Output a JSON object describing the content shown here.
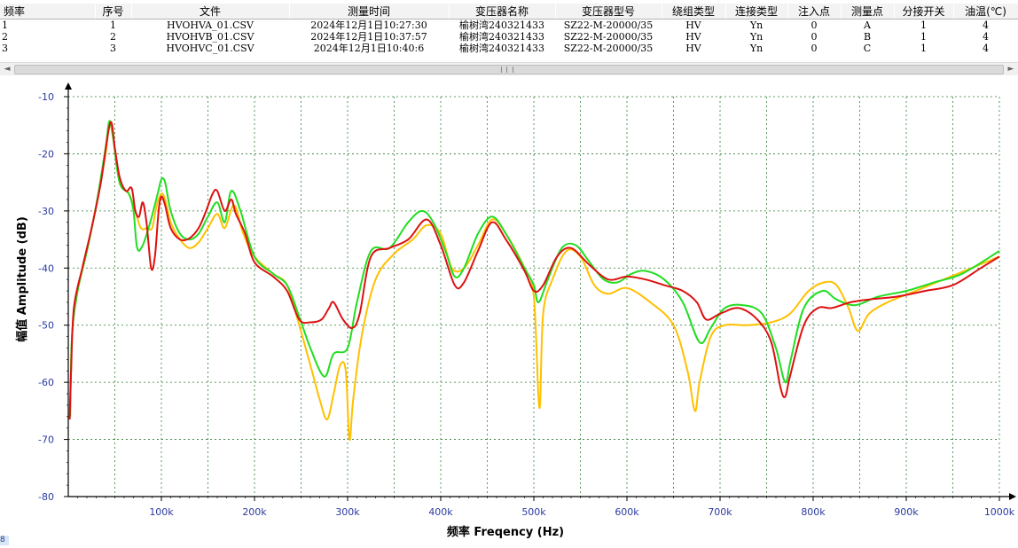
{
  "table": {
    "columns": [
      "频率",
      "序号",
      "文件",
      "测量时间",
      "变压器名称",
      "变压器型号",
      "绕组类型",
      "连接类型",
      "注入点",
      "测量点",
      "分接开关",
      "油温(℃)"
    ],
    "rows": [
      [
        "1",
        "1",
        "HVOHVA_01.CSV",
        "2024年12月1日10:27:30",
        "榆树湾240321433",
        "SZ22-M-20000/35",
        "HV",
        "Yn",
        "0",
        "A",
        "1",
        "4"
      ],
      [
        "2",
        "2",
        "HVOHVB_01.CSV",
        "2024年12月1日10:37:57",
        "榆树湾240321433",
        "SZ22-M-20000/35",
        "HV",
        "Yn",
        "0",
        "B",
        "1",
        "4"
      ],
      [
        "3",
        "3",
        "HVOHVC_01.CSV",
        "2024年12月1日10:40:6",
        "榆树湾240321433",
        "SZ22-M-20000/35",
        "HV",
        "Yn",
        "0",
        "C",
        "1",
        "4"
      ]
    ]
  },
  "scrollbar": {
    "left_arrow": "◄",
    "right_arrow": "►"
  },
  "corner_tag": "8",
  "chart_data": {
    "type": "line",
    "title": "",
    "xlabel": "频率 Freqency (Hz)",
    "ylabel": "幅值 Amplitude (dB)",
    "xlim": [
      0,
      1000000
    ],
    "ylim": [
      -80,
      -10
    ],
    "x_ticks": [
      100000,
      200000,
      300000,
      400000,
      500000,
      600000,
      700000,
      800000,
      900000,
      1000000
    ],
    "x_tick_labels": [
      "100k",
      "200k",
      "300k",
      "400k",
      "500k",
      "600k",
      "700k",
      "800k",
      "900k",
      "1000k"
    ],
    "y_ticks": [
      -10,
      -20,
      -30,
      -40,
      -50,
      -60,
      -70,
      -80
    ],
    "y_tick_labels": [
      "-10",
      "-20",
      "-30",
      "-40",
      "-50",
      "-60",
      "-70",
      "-80"
    ],
    "grid": true,
    "series": [
      {
        "color": "#ffc000",
        "points": [
          [
            2000,
            -66
          ],
          [
            4000,
            -52
          ],
          [
            10000,
            -44
          ],
          [
            20000,
            -37
          ],
          [
            30000,
            -29
          ],
          [
            40000,
            -20
          ],
          [
            44000,
            -15
          ],
          [
            48000,
            -17
          ],
          [
            55000,
            -25
          ],
          [
            65000,
            -27
          ],
          [
            72000,
            -30
          ],
          [
            78000,
            -33
          ],
          [
            85000,
            -33
          ],
          [
            90000,
            -33
          ],
          [
            95000,
            -29
          ],
          [
            100000,
            -27
          ],
          [
            104000,
            -28
          ],
          [
            110000,
            -32
          ],
          [
            120000,
            -35
          ],
          [
            130000,
            -36.5
          ],
          [
            140000,
            -35.5
          ],
          [
            150000,
            -33
          ],
          [
            160000,
            -30.5
          ],
          [
            168000,
            -33
          ],
          [
            178000,
            -29
          ],
          [
            188000,
            -34
          ],
          [
            200000,
            -38
          ],
          [
            220000,
            -41
          ],
          [
            235000,
            -43
          ],
          [
            248000,
            -50
          ],
          [
            260000,
            -57
          ],
          [
            270000,
            -63
          ],
          [
            278000,
            -66.5
          ],
          [
            285000,
            -62
          ],
          [
            292000,
            -57
          ],
          [
            298000,
            -58
          ],
          [
            302000,
            -70
          ],
          [
            306000,
            -63
          ],
          [
            315000,
            -52
          ],
          [
            330000,
            -42
          ],
          [
            350000,
            -37.5
          ],
          [
            370000,
            -35
          ],
          [
            385000,
            -32.5
          ],
          [
            400000,
            -34
          ],
          [
            412000,
            -40
          ],
          [
            425000,
            -40
          ],
          [
            440000,
            -36
          ],
          [
            455000,
            -31.5
          ],
          [
            470000,
            -34
          ],
          [
            490000,
            -40
          ],
          [
            500000,
            -45
          ],
          [
            506000,
            -64.5
          ],
          [
            510000,
            -48
          ],
          [
            520000,
            -42
          ],
          [
            535000,
            -37
          ],
          [
            550000,
            -38
          ],
          [
            565000,
            -43
          ],
          [
            580000,
            -44.5
          ],
          [
            600000,
            -43.5
          ],
          [
            625000,
            -46
          ],
          [
            650000,
            -50
          ],
          [
            665000,
            -58
          ],
          [
            673000,
            -65
          ],
          [
            678000,
            -60
          ],
          [
            690000,
            -52
          ],
          [
            705000,
            -50
          ],
          [
            730000,
            -50
          ],
          [
            755000,
            -49.5
          ],
          [
            775000,
            -48
          ],
          [
            795000,
            -44
          ],
          [
            812000,
            -42.5
          ],
          [
            825000,
            -43
          ],
          [
            838000,
            -47
          ],
          [
            848000,
            -51
          ],
          [
            860000,
            -48
          ],
          [
            880000,
            -46
          ],
          [
            910000,
            -44
          ],
          [
            940000,
            -42
          ],
          [
            970000,
            -40
          ],
          [
            1000000,
            -38
          ]
        ]
      },
      {
        "color": "#22dd22",
        "points": [
          [
            2000,
            -66
          ],
          [
            4000,
            -52
          ],
          [
            10000,
            -44
          ],
          [
            20000,
            -37
          ],
          [
            30000,
            -29
          ],
          [
            40000,
            -19
          ],
          [
            44000,
            -14.3
          ],
          [
            48000,
            -17
          ],
          [
            55000,
            -25
          ],
          [
            65000,
            -27
          ],
          [
            70000,
            -30
          ],
          [
            74000,
            -36.5
          ],
          [
            80000,
            -36
          ],
          [
            88000,
            -32
          ],
          [
            96000,
            -27
          ],
          [
            100000,
            -24.5
          ],
          [
            104000,
            -25
          ],
          [
            110000,
            -30
          ],
          [
            120000,
            -34
          ],
          [
            130000,
            -35
          ],
          [
            140000,
            -34
          ],
          [
            150000,
            -31
          ],
          [
            160000,
            -28.5
          ],
          [
            168000,
            -32
          ],
          [
            175000,
            -26.5
          ],
          [
            185000,
            -30
          ],
          [
            200000,
            -38
          ],
          [
            220000,
            -41
          ],
          [
            235000,
            -43
          ],
          [
            248000,
            -48.5
          ],
          [
            260000,
            -54
          ],
          [
            275000,
            -59
          ],
          [
            285000,
            -55
          ],
          [
            300000,
            -54
          ],
          [
            310000,
            -46
          ],
          [
            325000,
            -37
          ],
          [
            345000,
            -36.5
          ],
          [
            365000,
            -32
          ],
          [
            380000,
            -30
          ],
          [
            392000,
            -32
          ],
          [
            405000,
            -37
          ],
          [
            415000,
            -41.5
          ],
          [
            425000,
            -40
          ],
          [
            440000,
            -34
          ],
          [
            455000,
            -31
          ],
          [
            470000,
            -34
          ],
          [
            490000,
            -40
          ],
          [
            500000,
            -43
          ],
          [
            505000,
            -46
          ],
          [
            515000,
            -42
          ],
          [
            530000,
            -36.5
          ],
          [
            545000,
            -36
          ],
          [
            560000,
            -39
          ],
          [
            575000,
            -42
          ],
          [
            590000,
            -42.5
          ],
          [
            605000,
            -41
          ],
          [
            620000,
            -40.5
          ],
          [
            640000,
            -42
          ],
          [
            660000,
            -46
          ],
          [
            678000,
            -53
          ],
          [
            690000,
            -50.5
          ],
          [
            705000,
            -47
          ],
          [
            725000,
            -46.5
          ],
          [
            745000,
            -48
          ],
          [
            760000,
            -54
          ],
          [
            770000,
            -60
          ],
          [
            776000,
            -56
          ],
          [
            790000,
            -47
          ],
          [
            810000,
            -44
          ],
          [
            825000,
            -45.5
          ],
          [
            845000,
            -46.5
          ],
          [
            870000,
            -45
          ],
          [
            900000,
            -44
          ],
          [
            930000,
            -42.5
          ],
          [
            960000,
            -41
          ],
          [
            1000000,
            -37
          ]
        ]
      },
      {
        "color": "#dd1111",
        "points": [
          [
            1500,
            -66.5
          ],
          [
            3000,
            -58
          ],
          [
            6000,
            -47
          ],
          [
            15000,
            -40
          ],
          [
            25000,
            -33
          ],
          [
            35000,
            -25
          ],
          [
            45000,
            -14.6
          ],
          [
            50000,
            -19
          ],
          [
            55000,
            -24
          ],
          [
            62000,
            -26.5
          ],
          [
            68000,
            -26
          ],
          [
            72000,
            -30
          ],
          [
            76000,
            -31
          ],
          [
            80000,
            -28.5
          ],
          [
            84000,
            -32
          ],
          [
            89000,
            -40
          ],
          [
            93000,
            -38
          ],
          [
            97000,
            -30
          ],
          [
            100000,
            -27.5
          ],
          [
            104000,
            -29
          ],
          [
            110000,
            -33
          ],
          [
            120000,
            -35
          ],
          [
            130000,
            -34.8
          ],
          [
            140000,
            -33
          ],
          [
            148000,
            -30
          ],
          [
            155000,
            -27
          ],
          [
            160000,
            -26.5
          ],
          [
            168000,
            -30
          ],
          [
            175000,
            -28
          ],
          [
            180000,
            -30.5
          ],
          [
            190000,
            -34
          ],
          [
            200000,
            -39
          ],
          [
            220000,
            -41.5
          ],
          [
            235000,
            -44
          ],
          [
            248000,
            -49
          ],
          [
            260000,
            -49.5
          ],
          [
            272000,
            -49
          ],
          [
            280000,
            -47
          ],
          [
            285000,
            -46
          ],
          [
            295000,
            -49
          ],
          [
            305000,
            -50.5
          ],
          [
            313000,
            -48
          ],
          [
            325000,
            -38
          ],
          [
            345000,
            -36.5
          ],
          [
            365000,
            -35
          ],
          [
            385000,
            -31.5
          ],
          [
            400000,
            -36
          ],
          [
            415000,
            -43
          ],
          [
            425000,
            -42.5
          ],
          [
            440000,
            -37
          ],
          [
            455000,
            -32
          ],
          [
            470000,
            -35
          ],
          [
            490000,
            -40.5
          ],
          [
            500000,
            -44
          ],
          [
            510000,
            -43
          ],
          [
            525000,
            -38
          ],
          [
            540000,
            -36.5
          ],
          [
            560000,
            -39.5
          ],
          [
            580000,
            -42
          ],
          [
            600000,
            -41.5
          ],
          [
            620000,
            -42
          ],
          [
            640000,
            -43
          ],
          [
            660000,
            -44
          ],
          [
            675000,
            -46
          ],
          [
            685000,
            -49
          ],
          [
            700000,
            -48
          ],
          [
            720000,
            -47
          ],
          [
            740000,
            -49
          ],
          [
            755000,
            -53
          ],
          [
            765000,
            -61
          ],
          [
            770000,
            -62.5
          ],
          [
            775000,
            -59
          ],
          [
            790000,
            -50
          ],
          [
            805000,
            -47
          ],
          [
            820000,
            -47
          ],
          [
            840000,
            -46
          ],
          [
            860000,
            -45.5
          ],
          [
            890000,
            -45
          ],
          [
            920000,
            -44
          ],
          [
            950000,
            -43
          ],
          [
            980000,
            -40
          ],
          [
            1000000,
            -38
          ]
        ]
      }
    ]
  }
}
